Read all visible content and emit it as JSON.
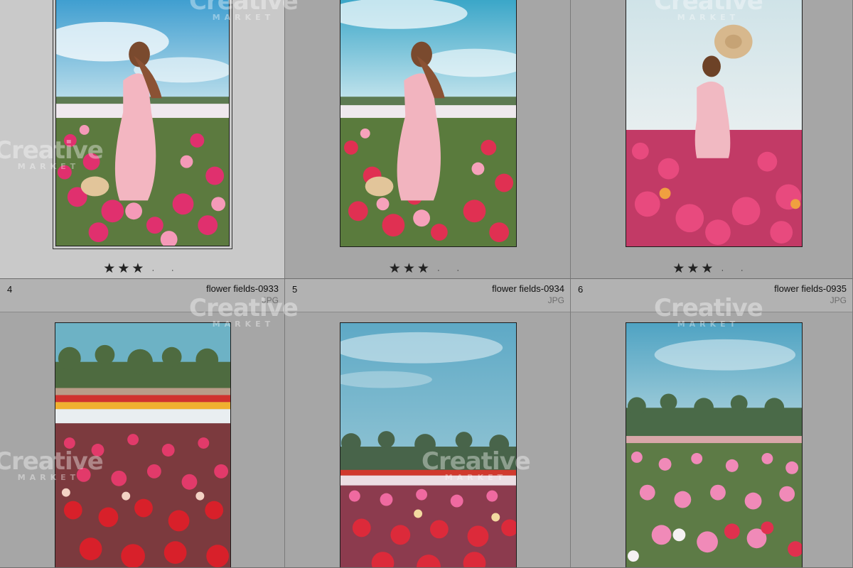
{
  "cells": [
    {
      "index": "",
      "filename": "",
      "filetype": "",
      "rating": "★★★",
      "dots": "· ·",
      "selected": true
    },
    {
      "index": "",
      "filename": "",
      "filetype": "",
      "rating": "★★★",
      "dots": "· ·",
      "selected": false
    },
    {
      "index": "",
      "filename": "",
      "filetype": "",
      "rating": "★★★",
      "dots": "· ·",
      "selected": false
    },
    {
      "index": "4",
      "filename": "flower fields-0933",
      "filetype": "JPG",
      "rating": "",
      "selected": false
    },
    {
      "index": "5",
      "filename": "flower fields-0934",
      "filetype": "JPG",
      "rating": "",
      "selected": false
    },
    {
      "index": "6",
      "filename": "flower fields-0935",
      "filetype": "JPG",
      "rating": "",
      "selected": false
    }
  ],
  "watermark": {
    "brand": "Creative",
    "sub": "MARKET"
  },
  "colors": {
    "sky": "#5fb0c8",
    "flower_pink": "#e8457a",
    "dress": "#f1b9c2",
    "foliage": "#4f7a3a"
  }
}
